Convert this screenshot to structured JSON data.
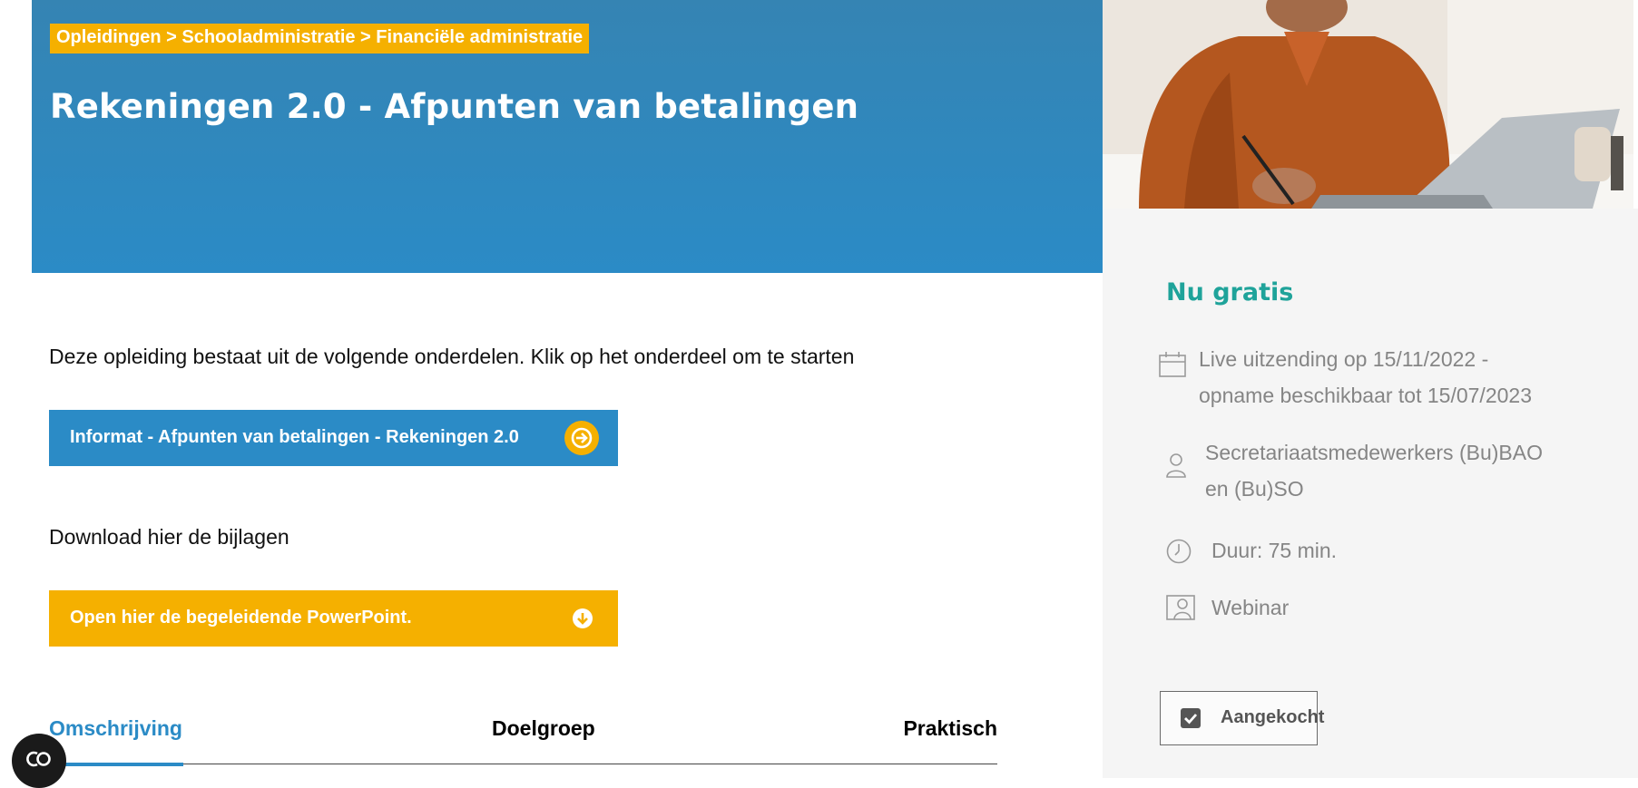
{
  "header": {
    "breadcrumb": "Opleidingen > Schooladministratie > Financiële administratie",
    "title": "Rekeningen 2.0 - Afpunten van betalingen"
  },
  "main": {
    "intro": "Deze opleiding bestaat uit de volgende onderdelen. Klik op het onderdeel om te starten",
    "module_button": "Informat - Afpunten van betalingen - Rekeningen 2.0",
    "download_intro": "Download hier de bijlagen",
    "download_button": "Open hier de begeleidende PowerPoint."
  },
  "tabs": [
    {
      "label": "Omschrijving",
      "active": true
    },
    {
      "label": "Doelgroep",
      "active": false
    },
    {
      "label": "Praktisch",
      "active": false
    }
  ],
  "sidebar": {
    "price": "Nu gratis",
    "info": [
      {
        "icon": "calendar-icon",
        "lines": [
          "Live uitzending op 15/11/2022 -",
          "opname beschikbaar tot 15/07/2023"
        ]
      },
      {
        "icon": "person-icon",
        "lines": [
          "Secretariaatsmedewerkers (Bu)BAO",
          "en (Bu)SO"
        ]
      },
      {
        "icon": "clock-icon",
        "lines": [
          "Duur: 75 min."
        ]
      },
      {
        "icon": "webinar-icon",
        "lines": [
          "Webinar"
        ]
      }
    ],
    "purchased_label": "Aangekocht"
  },
  "colors": {
    "primary_blue": "#2b8bc6",
    "accent_yellow": "#f5b000",
    "price_teal": "#1fa39a"
  }
}
